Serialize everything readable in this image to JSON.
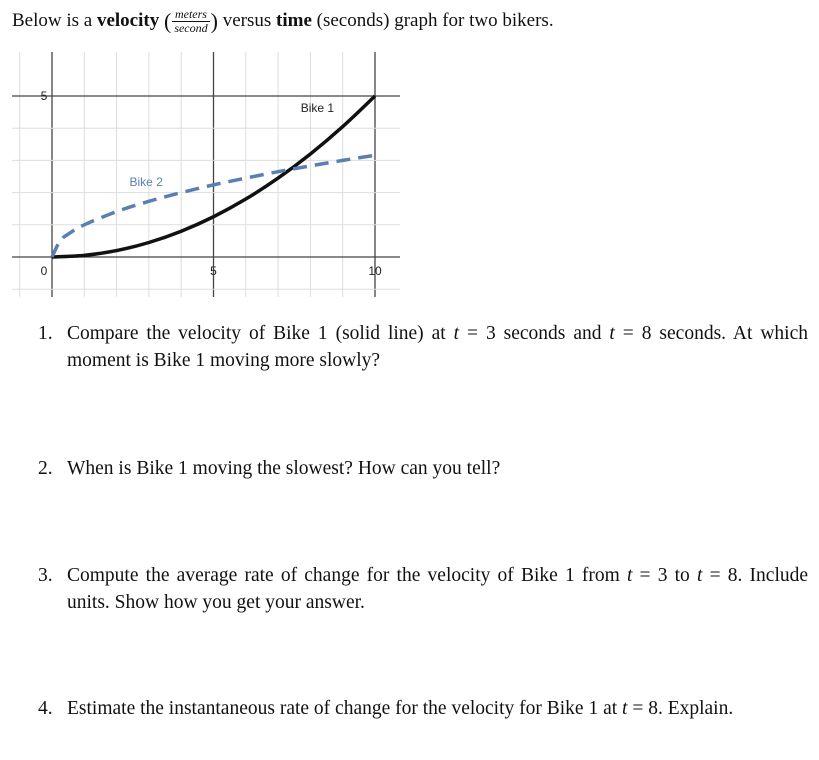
{
  "intro": {
    "before": "Below is a ",
    "velocity": "velocity",
    "unit_num": "meters",
    "unit_den": "second",
    "mid": " versus ",
    "time": "time",
    "after": " (seconds) graph for two bikers."
  },
  "chart_data": {
    "type": "line",
    "xlim": [
      -1.3,
      10.8
    ],
    "ylim": [
      -1.2,
      5.7
    ],
    "grid": true,
    "x_ticks": [
      "0",
      "5",
      "10"
    ],
    "y_ticks": [
      "5"
    ],
    "series": [
      {
        "name": "Bike 1",
        "style": "solid",
        "color": "#111111",
        "x": [
          0,
          1,
          2,
          3,
          4,
          5,
          6,
          7,
          8,
          9,
          10
        ],
        "y": [
          0,
          0.05,
          0.2,
          0.45,
          0.8,
          1.25,
          1.8,
          2.45,
          3.2,
          4.05,
          5
        ]
      },
      {
        "name": "Bike 2",
        "style": "dashed",
        "color": "#5a7fb0",
        "x": [
          0,
          0.25,
          0.5,
          1,
          2,
          3,
          4,
          5,
          6,
          7,
          8,
          9,
          10
        ],
        "y": [
          0,
          0.5,
          0.71,
          1,
          1.41,
          1.73,
          2,
          2.24,
          2.45,
          2.65,
          2.83,
          3,
          3.16
        ]
      }
    ]
  },
  "questions": [
    {
      "num": "1.",
      "html": "Compare the velocity of Bike 1 (solid line) at <i>t</i> = 3 seconds and <i>t</i> = 8 seconds. At which moment is Bike 1 moving more slowly?"
    },
    {
      "num": "2.",
      "html": "When is Bike 1 moving the slowest? How can you tell?"
    },
    {
      "num": "3.",
      "html": "Compute the average rate of change for the velocity of Bike 1 from <i>t</i> = 3 to <i>t</i> = 8. Include units. Show how you get your answer."
    },
    {
      "num": "4.",
      "html": "Estimate the instantaneous rate of change for the velocity for Bike 1 at <i>t</i> = 8. Explain."
    }
  ]
}
